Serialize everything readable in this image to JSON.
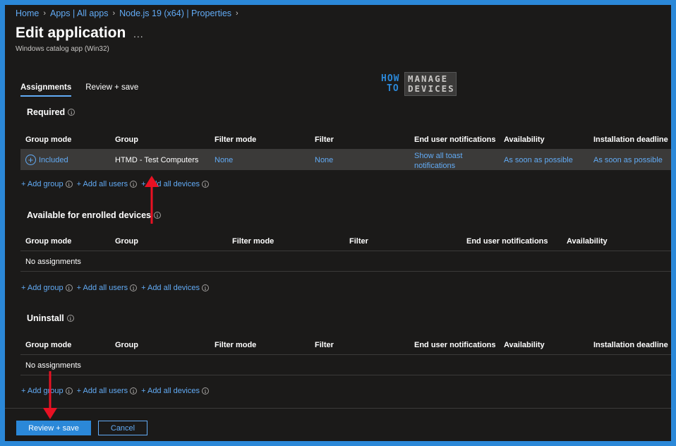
{
  "breadcrumb": [
    "Home",
    "Apps | All apps",
    "Node.js 19 (x64) | Properties"
  ],
  "page": {
    "title": "Edit application",
    "more": "...",
    "subtitle": "Windows catalog app (Win32)"
  },
  "logo": {
    "how": "HOW",
    "to": "TO",
    "manage": "MANAGE",
    "devices": "DEVICES"
  },
  "tabs": [
    {
      "label": "Assignments",
      "active": true
    },
    {
      "label": "Review + save",
      "active": false
    }
  ],
  "required": {
    "title": "Required",
    "columns": [
      "Group mode",
      "Group",
      "Filter mode",
      "Filter",
      "End user notifications",
      "Availability",
      "Installation deadline"
    ],
    "row": {
      "group_mode": "Included",
      "group": "HTMD - Test Computers",
      "filter_mode": "None",
      "filter": "None",
      "notifications": "Show all toast notifications",
      "availability": "As soon as possible",
      "deadline": "As soon as possible"
    }
  },
  "available": {
    "title": "Available for enrolled devices",
    "columns": [
      "Group mode",
      "Group",
      "Filter mode",
      "Filter",
      "End user notifications",
      "Availability"
    ],
    "empty": "No assignments"
  },
  "uninstall": {
    "title": "Uninstall",
    "columns": [
      "Group mode",
      "Group",
      "Filter mode",
      "Filter",
      "End user notifications",
      "Availability",
      "Installation deadline"
    ],
    "empty": "No assignments"
  },
  "add_links": {
    "group": "+ Add group",
    "users": "+ Add all users",
    "devices": "+ Add all devices"
  },
  "footer": {
    "primary": "Review + save",
    "secondary": "Cancel"
  },
  "colors": {
    "accent": "#62abf5",
    "primary_button": "#2b88d8",
    "background": "#1b1a19",
    "annotation_arrow": "#e81123"
  }
}
